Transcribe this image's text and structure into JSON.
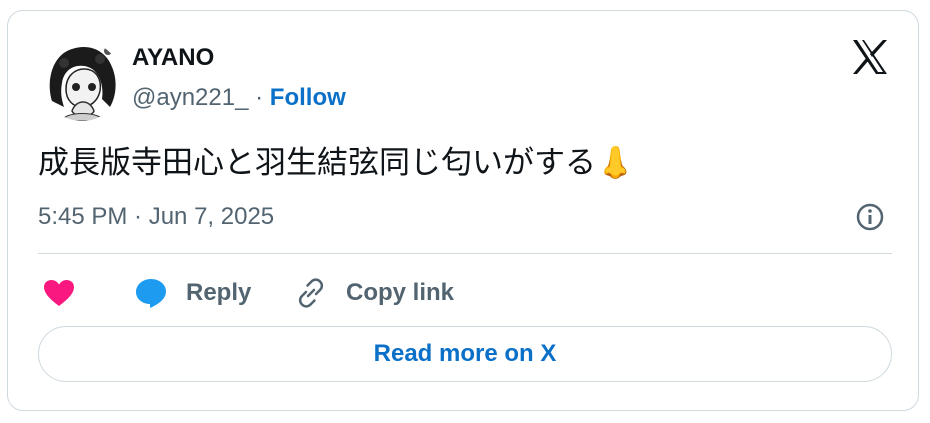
{
  "author": {
    "name": "AYANO",
    "handle": "@ayn221_",
    "separator": " · ",
    "follow_label": "Follow"
  },
  "brand": {
    "logo_icon": "x-logo-icon"
  },
  "tweet": {
    "text": "成長版寺田心と羽生結弦同じ匂いがする",
    "emoji": "👃",
    "timestamp": "5:45 PM · Jun 7, 2025",
    "info_icon": "info-icon"
  },
  "actions": {
    "like_icon": "heart-icon",
    "reply_icon": "speech-bubble-icon",
    "reply_label": "Reply",
    "copy_icon": "link-icon",
    "copy_label": "Copy link"
  },
  "read_more": {
    "label": "Read more on X"
  },
  "colors": {
    "text_primary": "#0f1419",
    "text_secondary": "#536471",
    "accent_blue": "#0b70c8",
    "like_pink": "#f91880",
    "reply_blue": "#1d9bf0",
    "border": "#cfd9de"
  }
}
